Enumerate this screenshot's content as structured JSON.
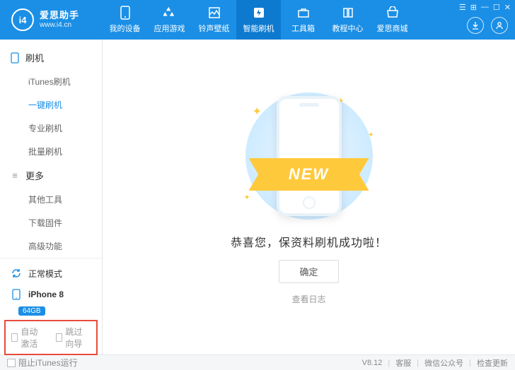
{
  "app": {
    "name": "爱思助手",
    "url": "www.i4.cn",
    "version": "V8.12"
  },
  "nav": [
    {
      "id": "devices",
      "label": "我的设备"
    },
    {
      "id": "games",
      "label": "应用游戏"
    },
    {
      "id": "ringtones",
      "label": "铃声壁纸"
    },
    {
      "id": "flash",
      "label": "智能刷机",
      "active": true
    },
    {
      "id": "toolbox",
      "label": "工具箱"
    },
    {
      "id": "tutorial",
      "label": "教程中心"
    },
    {
      "id": "store",
      "label": "爱思商城"
    }
  ],
  "sidebar": {
    "group1": {
      "title": "刷机",
      "items": [
        {
          "label": "iTunes刷机"
        },
        {
          "label": "一键刷机",
          "active": true
        },
        {
          "label": "专业刷机"
        },
        {
          "label": "批量刷机"
        }
      ]
    },
    "group2": {
      "title": "更多",
      "items": [
        {
          "label": "其他工具"
        },
        {
          "label": "下载固件"
        },
        {
          "label": "高级功能"
        }
      ]
    },
    "mode": "正常模式",
    "device": {
      "name": "iPhone 8",
      "storage": "64GB"
    },
    "opts": {
      "auto_activate": "自动激活",
      "skip_guide": "跳过向导"
    }
  },
  "main": {
    "ribbon": "NEW",
    "success_msg": "恭喜您，保资料刷机成功啦！",
    "ok": "确定",
    "view_log": "查看日志"
  },
  "footer": {
    "block_itunes": "阻止iTunes运行",
    "support": "客服",
    "wechat": "微信公众号",
    "check_update": "检查更新"
  }
}
